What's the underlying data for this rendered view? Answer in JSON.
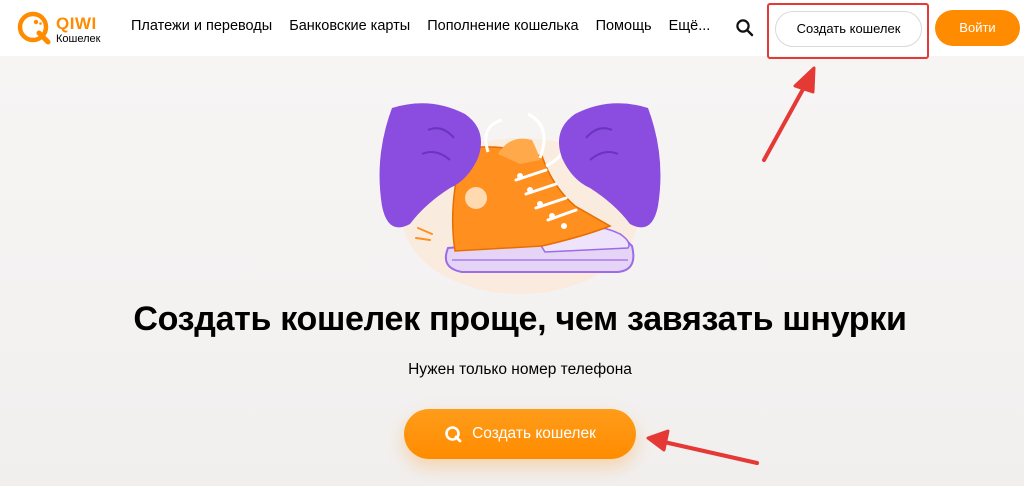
{
  "header": {
    "logo": {
      "brand": "QIWI",
      "subtitle": "Кошелек"
    },
    "nav": [
      {
        "label": "Платежи и переводы"
      },
      {
        "label": "Банковские карты"
      },
      {
        "label": "Пополнение кошелька"
      },
      {
        "label": "Помощь"
      },
      {
        "label": "Ещё..."
      }
    ],
    "create_wallet_label": "Создать кошелек",
    "login_label": "Войти"
  },
  "main": {
    "headline": "Создать кошелек проще, чем завязать шнурки",
    "subheadline": "Нужен только номер телефона",
    "cta_label": "Создать кошелек"
  },
  "colors": {
    "accent": "#ff8c00",
    "annotation": "#e53935",
    "illustration_purple": "#8a4de0"
  }
}
